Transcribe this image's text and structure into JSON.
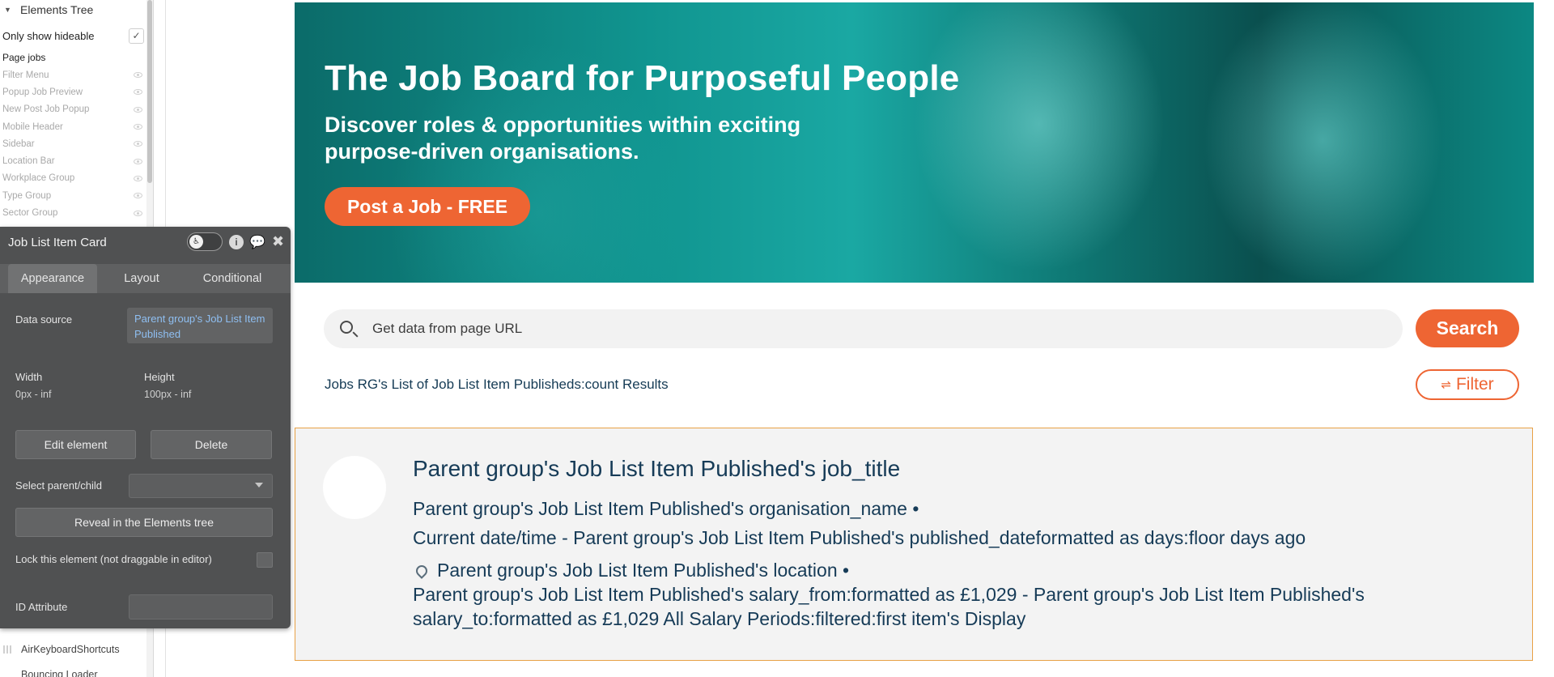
{
  "tree": {
    "header": "Elements Tree",
    "hideable_label": "Only show hideable",
    "hideable_checked": "✓",
    "page_label": "Page jobs",
    "items": [
      "Filter Menu",
      "Popup Job Preview",
      "New Post Job Popup",
      "Mobile Header",
      "Sidebar",
      "Location Bar",
      "Workplace Group",
      "Type Group",
      "Sector Group"
    ],
    "bottom_items": [
      "AirKeyboardShortcuts",
      "Bouncing Loader"
    ]
  },
  "panel": {
    "title": "Job List Item Card",
    "tabs": [
      "Appearance",
      "Layout",
      "Conditional"
    ],
    "data_source_label": "Data source",
    "data_source_value": "Parent group's Job List Item Published",
    "width_label": "Width",
    "width_value": "0px - inf",
    "height_label": "Height",
    "height_value": "100px - inf",
    "edit_button": "Edit element",
    "delete_button": "Delete",
    "select_parent_label": "Select parent/child",
    "reveal_button": "Reveal in the Elements tree",
    "lock_label": "Lock this element (not draggable in editor)",
    "id_label": "ID Attribute"
  },
  "hero": {
    "title": "The Job Board for Purposeful People",
    "subtitle": "Discover roles & opportunities within exciting purpose-driven organisations.",
    "cta": "Post a Job - FREE"
  },
  "search": {
    "value": "Get data from page URL",
    "button": "Search"
  },
  "results": {
    "text": "Jobs RG's List of Job List Item Publisheds:count Results",
    "filter_button": "Filter"
  },
  "card": {
    "job_title": "Parent group's Job List Item Published's job_title",
    "organisation": "Parent group's Job List Item Published's organisation_name •",
    "posted": "Current date/time - Parent group's Job List Item Published's published_dateformatted as days:floor  days ago",
    "location": "Parent group's Job List Item Published's location •",
    "salary": "Parent group's Job List Item Published's salary_from:formatted as £1,029 - Parent group's Job List Item Published's salary_to:formatted as £1,029 All Salary Periods:filtered:first item's Display"
  },
  "colors": {
    "accent": "#ee6533",
    "text_dark": "#153b55",
    "panel_bg": "#505152",
    "card_border": "#e8a146"
  }
}
